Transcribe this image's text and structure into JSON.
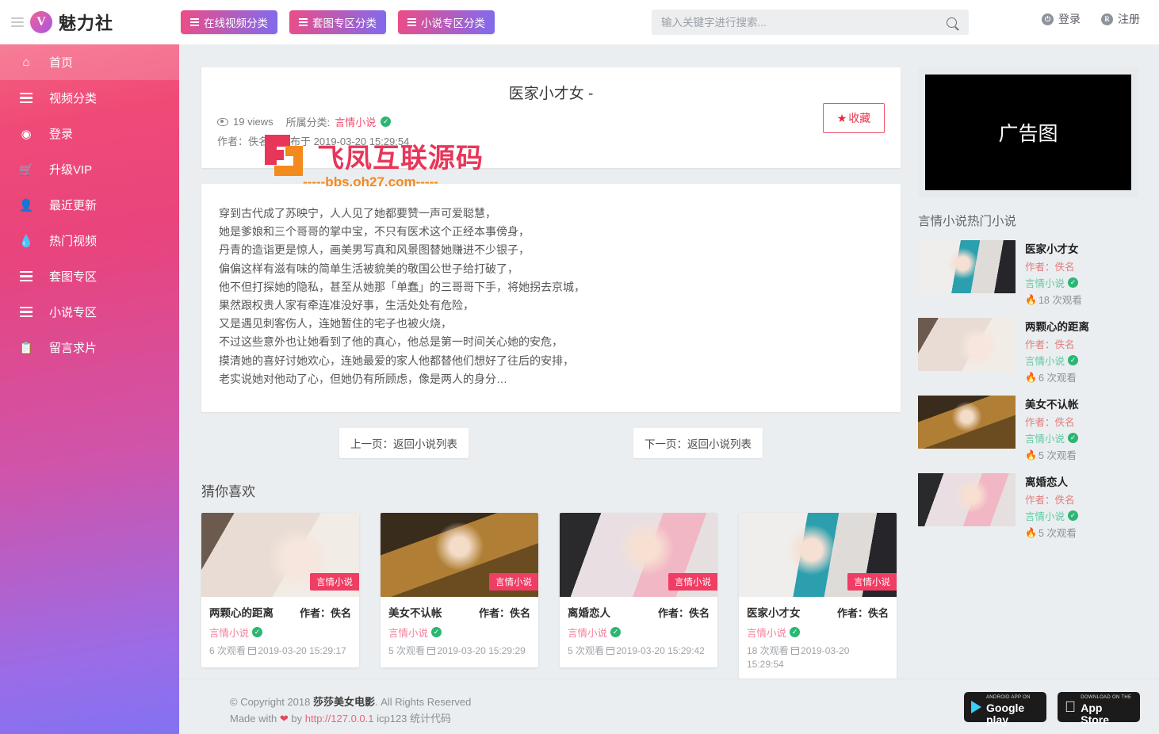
{
  "header": {
    "menu_icon": "hamburger-icon",
    "logo_mark": "V",
    "logo_text": "魅力社",
    "nav_buttons": [
      {
        "label": "在线视频分类"
      },
      {
        "label": "套图专区分类"
      },
      {
        "label": "小说专区分类"
      }
    ],
    "search": {
      "placeholder": "输入关键字进行搜索...",
      "value": "",
      "icon": "search-icon"
    },
    "account": [
      {
        "label": "登录",
        "mark": "⏻"
      },
      {
        "label": "注册",
        "mark": "R"
      }
    ]
  },
  "sidebar": {
    "items": [
      {
        "label": "首页",
        "icon": "home-icon",
        "active": true
      },
      {
        "label": "视频分类",
        "icon": "list-icon",
        "active": false
      },
      {
        "label": "登录",
        "icon": "user-circle-icon",
        "active": false
      },
      {
        "label": "升级VIP",
        "icon": "cart-icon",
        "active": false
      },
      {
        "label": "最近更新",
        "icon": "person-icon",
        "active": false
      },
      {
        "label": "热门视频",
        "icon": "flame-icon",
        "active": false
      },
      {
        "label": "套图专区",
        "icon": "list-icon",
        "active": false
      },
      {
        "label": "小说专区",
        "icon": "list-icon",
        "active": false
      },
      {
        "label": "留言求片",
        "icon": "clipboard-icon",
        "active": false
      }
    ]
  },
  "article": {
    "title": "医家小才女 -",
    "views": "19 views",
    "category_prefix": "所属分类:",
    "category": "言情小说",
    "author_label": "作者：佚名",
    "published_label": "发布于 2019-03-20 15:29:54",
    "favorite_button": "收藏",
    "body_lines": [
      "穿到古代成了苏映宁，人人见了她都要赞一声可爱聪慧，",
      "她是爹娘和三个哥哥的掌中宝，不只有医术这个正经本事傍身，",
      "丹青的造诣更是惊人，画美男写真和风景图替她赚进不少银子，",
      "偏偏这样有滋有味的简单生活被貌美的敬国公世子给打破了，",
      "他不但打探她的隐私，甚至从她那「单蠢」的三哥哥下手，将她拐去京城，",
      "果然跟权贵人家有牵连准没好事，生活处处有危险，",
      "又是遇见刺客伤人，连她暂住的宅子也被火烧，",
      "不过这些意外也让她看到了他的真心，他总是第一时间关心她的安危，",
      "摸清她的喜好讨她欢心，连她最爱的家人他都替他们想好了往后的安排，",
      "老实说她对他动了心，但她仍有所顾虑，像是两人的身分…"
    ],
    "watermark": {
      "text": "飞凤互联源码",
      "url": "-----bbs.oh27.com-----"
    }
  },
  "pager": {
    "prev": "上一页：返回小说列表",
    "next": "下一页：返回小说列表"
  },
  "guess": {
    "title": "猜你喜欢",
    "items": [
      {
        "name": "两颗心的距离",
        "author": "作者：佚名",
        "tag": "言情小说",
        "category": "言情小说",
        "views": "6 次观看",
        "date": "2019-03-20 15:29:17",
        "thumb": "ph1"
      },
      {
        "name": "美女不认帐",
        "author": "作者：佚名",
        "tag": "言情小说",
        "category": "言情小说",
        "views": "5 次观看",
        "date": "2019-03-20 15:29:29",
        "thumb": "ph2"
      },
      {
        "name": "离婚恋人",
        "author": "作者：佚名",
        "tag": "言情小说",
        "category": "言情小说",
        "views": "5 次观看",
        "date": "2019-03-20 15:29:42",
        "thumb": "ph3"
      },
      {
        "name": "医家小才女",
        "author": "作者：佚名",
        "tag": "言情小说",
        "category": "言情小说",
        "views": "18 次观看",
        "date": "2019-03-20 15:29:54",
        "thumb": "ph4"
      }
    ]
  },
  "rail": {
    "ad_label": "广告图",
    "hot_title": "言情小说热门小说",
    "hot_items": [
      {
        "name": "医家小才女",
        "author": "作者：佚名",
        "category": "言情小说",
        "views": "18 次观看",
        "thumb": "ph4"
      },
      {
        "name": "两颗心的距离",
        "author": "作者：佚名",
        "category": "言情小说",
        "views": "6 次观看",
        "thumb": "ph1"
      },
      {
        "name": "美女不认帐",
        "author": "作者：佚名",
        "category": "言情小说",
        "views": "5 次观看",
        "thumb": "ph2"
      },
      {
        "name": "离婚恋人",
        "author": "作者：佚名",
        "category": "言情小说",
        "views": "5 次观看",
        "thumb": "ph3"
      }
    ]
  },
  "footer": {
    "copy_prefix": "© Copyright 2018 ",
    "site_name": "莎莎美女电影",
    "copy_suffix": ". All Rights Reserved",
    "made_prefix": "Made with ",
    "made_by": " by ",
    "link": "http://127.0.0.1",
    "made_suffix": " icp123 统计代码",
    "badges": [
      {
        "sub": "ANDROID APP ON",
        "main": "Google play",
        "kind": "google-play"
      },
      {
        "sub": "Download on the",
        "main": "App Store",
        "kind": "app-store"
      }
    ]
  },
  "colors": {
    "brand_pink": "#ef3d64",
    "brand_purple": "#8272f2",
    "accent_red": "#e8253c",
    "verified_green": "#2bb673"
  }
}
